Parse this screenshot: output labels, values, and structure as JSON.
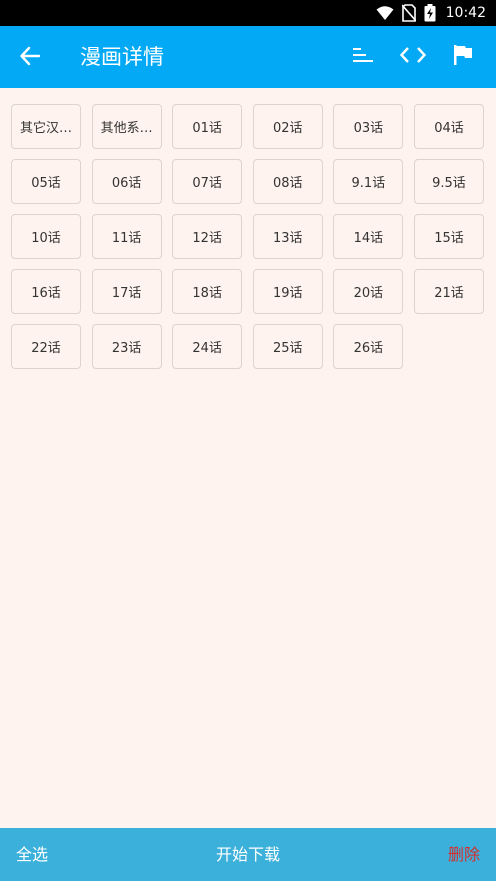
{
  "status_bar": {
    "time": "10:42",
    "icons": [
      "wifi-icon",
      "no-sim-icon",
      "battery-charging-icon"
    ]
  },
  "app_bar": {
    "title": "漫画详情",
    "back_icon": "arrow-left-icon",
    "actions": [
      "sort-icon",
      "code-icon",
      "flag-icon"
    ]
  },
  "chapters": [
    "其它汉…",
    "其他系…",
    "01话",
    "02话",
    "03话",
    "04话",
    "05话",
    "06话",
    "07话",
    "08话",
    "9.1话",
    "9.5话",
    "10话",
    "11话",
    "12话",
    "13话",
    "14话",
    "15话",
    "16话",
    "17话",
    "18话",
    "19话",
    "20话",
    "21话",
    "22话",
    "23话",
    "24话",
    "25话",
    "26话"
  ],
  "bottom_bar": {
    "select_all": "全选",
    "start_download": "开始下载",
    "delete": "删除"
  },
  "colors": {
    "app_bar": "#03a9f4",
    "bottom_bar": "#3bb0da",
    "background": "#fef3ee",
    "delete": "#d32f2f"
  }
}
